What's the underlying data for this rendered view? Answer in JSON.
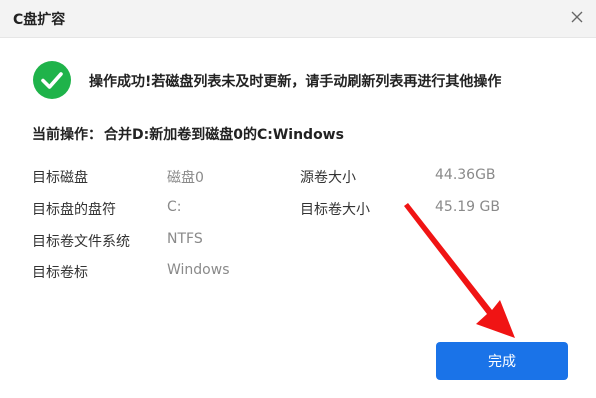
{
  "dialog": {
    "title": "C盘扩容",
    "success_message": "操作成功!若磁盘列表未及时更新，请手动刷新列表再进行其他操作",
    "current_operation_label": "当前操作：",
    "current_operation_value": "合并D:新加卷到磁盘0的C:Windows"
  },
  "details": {
    "target_disk_label": "目标磁盘",
    "target_disk_value": "磁盘0",
    "target_drive_letter_label": "目标盘的盘符",
    "target_drive_letter_value": "C:",
    "target_filesystem_label": "目标卷文件系统",
    "target_filesystem_value": "NTFS",
    "target_volume_label_label": "目标卷标",
    "target_volume_label_value": "Windows",
    "source_size_label": "源卷大小",
    "source_size_value": "44.36GB",
    "target_size_label": "目标卷大小",
    "target_size_value": "45.19 GB"
  },
  "buttons": {
    "done_label": "完成"
  },
  "colors": {
    "success_green": "#1fb34a",
    "primary_blue": "#1a73e8",
    "annotation_red": "#f01414"
  },
  "icons": {
    "close": "close-icon",
    "success": "check-circle-icon",
    "annotation": "red-arrow-icon"
  }
}
